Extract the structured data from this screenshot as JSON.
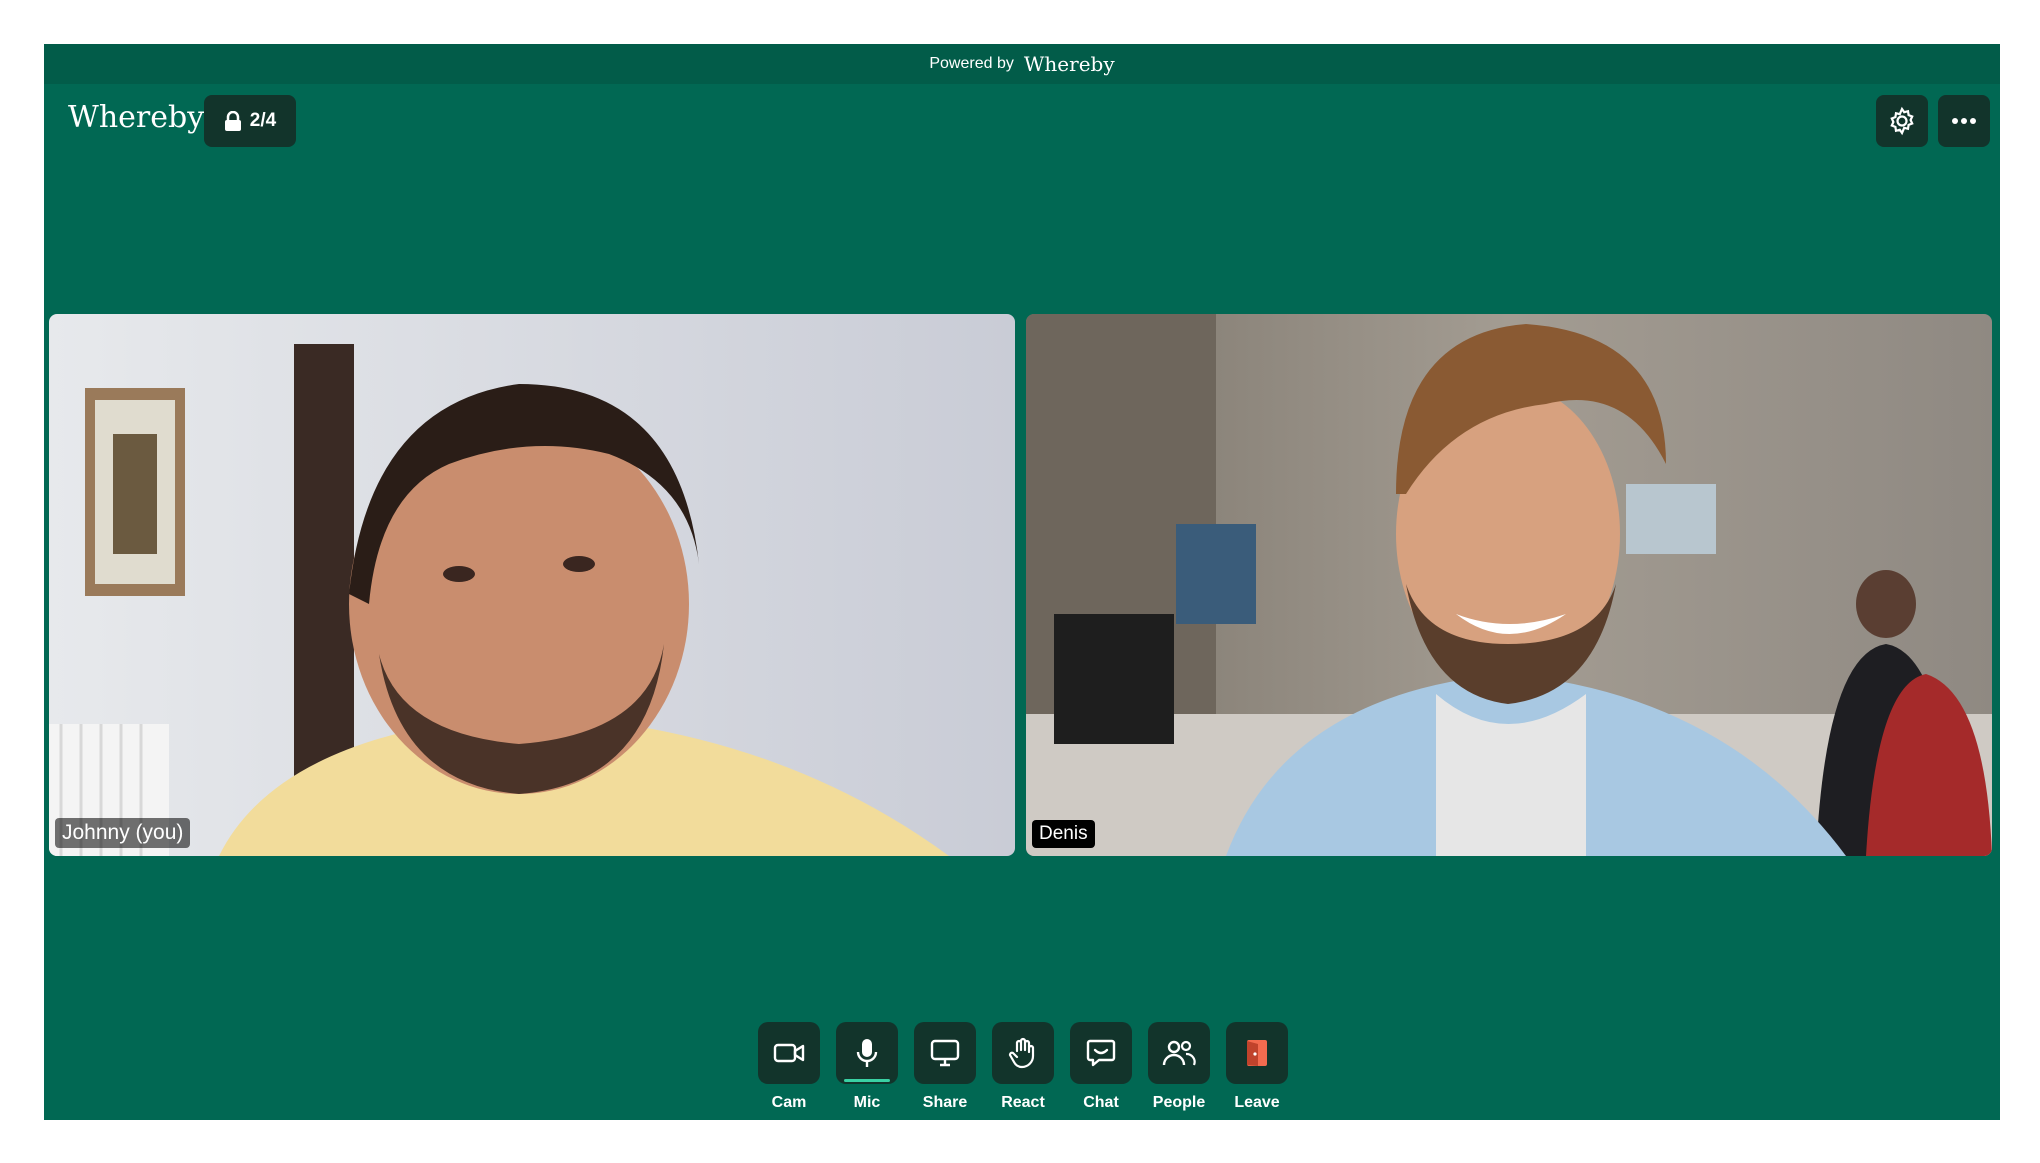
{
  "banner": {
    "prefix": "Powered by",
    "brand": "Whereby"
  },
  "header": {
    "logo": "Whereby",
    "room_count": "2/4"
  },
  "participants": [
    {
      "name": "Johnny (you)"
    },
    {
      "name": "Denis"
    }
  ],
  "controls": [
    {
      "label": "Cam",
      "icon": "camera-icon"
    },
    {
      "label": "Mic",
      "icon": "microphone-icon"
    },
    {
      "label": "Share",
      "icon": "screen-share-icon"
    },
    {
      "label": "React",
      "icon": "hand-wave-icon"
    },
    {
      "label": "Chat",
      "icon": "chat-bubble-icon"
    },
    {
      "label": "People",
      "icon": "people-icon"
    },
    {
      "label": "Leave",
      "icon": "leave-door-icon"
    }
  ],
  "colors": {
    "background": "#016853",
    "button": "#12342b",
    "leave_accent": "#f26b4f",
    "mic_active": "#3ad1a4"
  }
}
